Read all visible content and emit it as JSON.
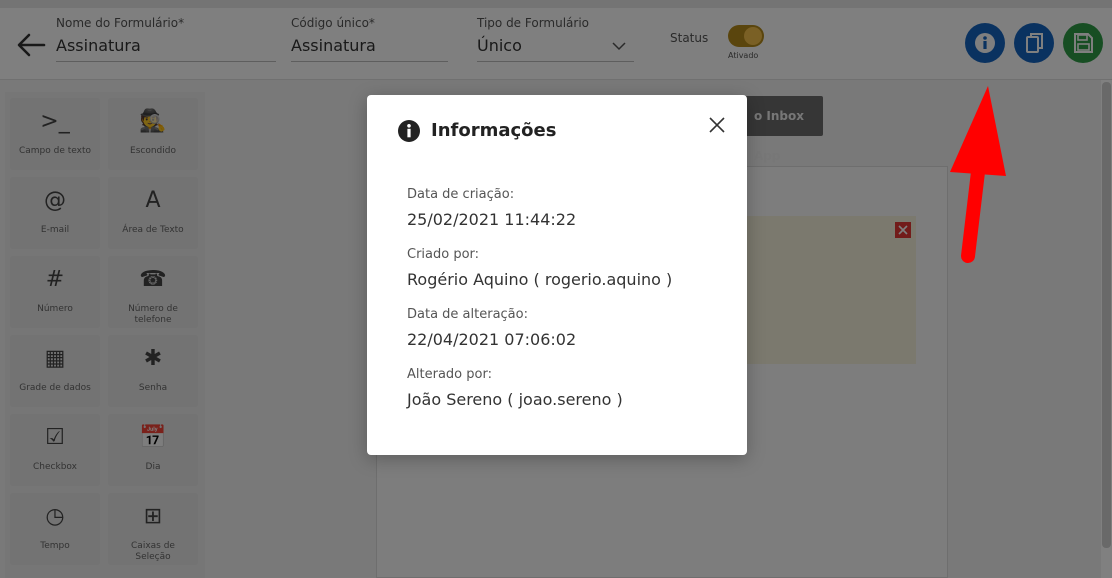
{
  "header": {
    "back_icon": "arrow-left-icon",
    "fields": [
      {
        "label": "Nome do Formulário*",
        "value": "Assinatura"
      },
      {
        "label": "Código único*",
        "value": "Assinatura"
      },
      {
        "label": "Tipo de Formulário",
        "value": "Único"
      }
    ],
    "status": {
      "label": "Status",
      "toggle_label": "Ativado",
      "on": true
    },
    "actions": [
      {
        "icon": "info-icon",
        "color": "#1565c0"
      },
      {
        "icon": "copy-icon",
        "color": "#1565c0"
      },
      {
        "icon": "save-icon",
        "color": "#2e9c47"
      }
    ]
  },
  "palette": [
    {
      "icon": "terminal-icon",
      "glyph": ">_",
      "label": "Campo de texto"
    },
    {
      "icon": "spy-icon",
      "glyph": "🕵",
      "label": "Escondido"
    },
    {
      "icon": "at-icon",
      "glyph": "@",
      "label": "E-mail"
    },
    {
      "icon": "font-icon",
      "glyph": "A",
      "label": "Área de Texto"
    },
    {
      "icon": "hash-icon",
      "glyph": "#",
      "label": "Número"
    },
    {
      "icon": "phone-icon",
      "glyph": "☎",
      "label": "Número de telefone"
    },
    {
      "icon": "grid-icon",
      "glyph": "▦",
      "label": "Grade de dados"
    },
    {
      "icon": "asterisk-icon",
      "glyph": "✱",
      "label": "Senha"
    },
    {
      "icon": "checkbox-icon",
      "glyph": "☑",
      "label": "Checkbox"
    },
    {
      "icon": "calendar-icon",
      "glyph": "📅",
      "label": "Dia"
    },
    {
      "icon": "clock-icon",
      "glyph": "◷",
      "label": "Tempo"
    },
    {
      "icon": "plus-square-icon",
      "glyph": "⊞",
      "label": "Caixas de Seleção"
    }
  ],
  "canvas": {
    "button_label": "o Inbox App"
  },
  "modal": {
    "title": "Informações",
    "rows": [
      {
        "label": "Data de criação:",
        "value": "25/02/2021 11:44:22"
      },
      {
        "label": "Criado por:",
        "value": "Rogério Aquino ( rogerio.aquino )"
      },
      {
        "label": "Data de alteração:",
        "value": "22/04/2021 07:06:02"
      },
      {
        "label": "Alterado por:",
        "value": "João Sereno ( joao.sereno )"
      }
    ]
  },
  "colors": {
    "accent": "#1565c0",
    "save": "#2e9c47",
    "toggle": "#f4c04a",
    "annotation": "#ff0000"
  }
}
